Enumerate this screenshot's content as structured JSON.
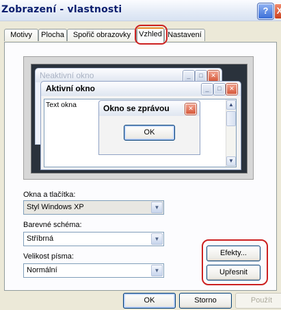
{
  "window": {
    "title": "Zobrazení - vlastnosti",
    "help_label": "?",
    "close_label": "X"
  },
  "tabs": [
    {
      "label": "Motivy"
    },
    {
      "label": "Plocha"
    },
    {
      "label": "Spořič obrazovky"
    },
    {
      "label": "Vzhled"
    },
    {
      "label": "Nastavení"
    }
  ],
  "active_tab": "Vzhled",
  "preview": {
    "inactive_window_title": "Neaktivní okno",
    "active_window_title": "Aktivní okno",
    "window_text": "Text okna",
    "message_box_title": "Okno se zprávou",
    "message_box_ok": "OK"
  },
  "settings": {
    "windows_buttons_label": "Okna a tlačítka:",
    "windows_buttons_value": "Styl Windows XP",
    "color_scheme_label": "Barevné schéma:",
    "color_scheme_value": "Stříbrná",
    "font_size_label": "Velikost písma:",
    "font_size_value": "Normální",
    "effects_button": "Efekty...",
    "advanced_button": "Upřesnit"
  },
  "footer": {
    "ok": "OK",
    "cancel": "Storno",
    "apply": "Použít"
  },
  "colors": {
    "highlight_ring": "#cc2020",
    "title_text": "#0a1e6e",
    "dialog_bg": "#ece9d8"
  }
}
